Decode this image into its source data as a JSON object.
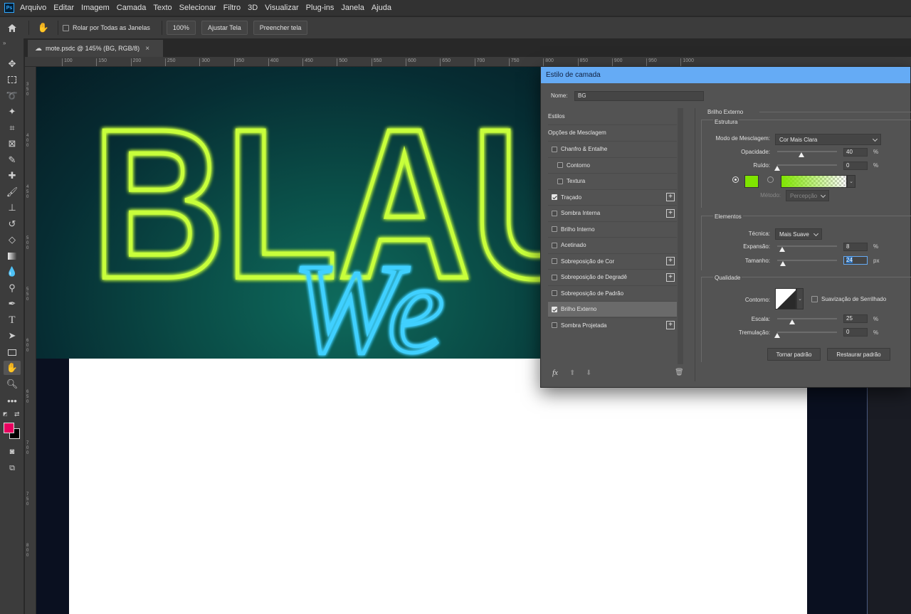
{
  "menu": {
    "logo": "Ps",
    "items": [
      "Arquivo",
      "Editar",
      "Imagem",
      "Camada",
      "Texto",
      "Selecionar",
      "Filtro",
      "3D",
      "Visualizar",
      "Plug-ins",
      "Janela",
      "Ajuda"
    ]
  },
  "options": {
    "scroll_all_label": "Rolar por Todas as Janelas",
    "zoom_100_label": "100%",
    "fit_screen_label": "Ajustar Tela",
    "fill_screen_label": "Preencher tela"
  },
  "document_tab": {
    "title": "mote.psdc @ 145% (BG, RGB/8)",
    "close": "×"
  },
  "ruler_top": [
    "100",
    "150",
    "200",
    "250",
    "300",
    "350",
    "400",
    "450",
    "500",
    "550",
    "600",
    "650",
    "700",
    "750",
    "800",
    "850",
    "900",
    "950",
    "1000"
  ],
  "ruler_left": [
    "350",
    "400",
    "450",
    "500",
    "550",
    "600",
    "650",
    "700",
    "750",
    "800"
  ],
  "canvas": {
    "neon_text_1": "BLAU",
    "neon_text_2": "We",
    "neon_green": "#c8ff3a",
    "neon_blue": "#3fd0ff"
  },
  "colors": {
    "foreground": "#e8005f",
    "background": "#000000",
    "glow_color": "#7fe400",
    "dialog_title_bg": "#65abf5"
  },
  "dialog": {
    "title": "Estilo de camada",
    "name_label": "Nome:",
    "name_value": "BG",
    "styles_header": "Estilos",
    "blend_options": "Opções de Mesclagem",
    "styles": [
      {
        "label": "Chanfro & Entalhe",
        "checked": false,
        "plus": false,
        "indent": false
      },
      {
        "label": "Contorno",
        "checked": false,
        "plus": false,
        "indent": true
      },
      {
        "label": "Textura",
        "checked": false,
        "plus": false,
        "indent": true
      },
      {
        "label": "Traçado",
        "checked": true,
        "plus": true,
        "indent": false
      },
      {
        "label": "Sombra Interna",
        "checked": false,
        "plus": true,
        "indent": false
      },
      {
        "label": "Brilho Interno",
        "checked": false,
        "plus": false,
        "indent": false
      },
      {
        "label": "Acetinado",
        "checked": false,
        "plus": false,
        "indent": false
      },
      {
        "label": "Sobreposição de Cor",
        "checked": false,
        "plus": true,
        "indent": false
      },
      {
        "label": "Sobreposição de Degradê",
        "checked": false,
        "plus": true,
        "indent": false
      },
      {
        "label": "Sobreposição de Padrão",
        "checked": false,
        "plus": false,
        "indent": false
      },
      {
        "label": "Brilho Externo",
        "checked": true,
        "plus": false,
        "indent": false,
        "selected": true
      },
      {
        "label": "Sombra Projetada",
        "checked": false,
        "plus": true,
        "indent": false
      }
    ],
    "fx_label": "fx",
    "panel_title": "Brilho Externo",
    "structure": {
      "title": "Estrutura",
      "blend_mode_label": "Modo de Mesclagem:",
      "blend_mode_value": "Cor Mais Clara",
      "opacity_label": "Opacidade:",
      "opacity_value": "40",
      "opacity_fraction": 0.4,
      "noise_label": "Ruído:",
      "noise_value": "0",
      "noise_fraction": 0.0,
      "percent": "%",
      "method_label": "Método:",
      "method_value": "Percepção"
    },
    "elements": {
      "title": "Elementos",
      "technique_label": "Técnica:",
      "technique_value": "Mais Suave",
      "spread_label": "Expansão:",
      "spread_value": "8",
      "spread_fraction": 0.08,
      "size_label": "Tamanho:",
      "size_value": "24",
      "size_fraction": 0.1,
      "px": "px"
    },
    "quality": {
      "title": "Qualidade",
      "contour_label": "Contorno:",
      "antialias_label": "Suavização de Serrilhado",
      "range_label": "Escala:",
      "range_value": "25",
      "range_fraction": 0.25,
      "jitter_label": "Tremulação:",
      "jitter_value": "0",
      "jitter_fraction": 0.0
    },
    "make_default": "Tornar padrão",
    "reset_default": "Restaurar padrão"
  }
}
